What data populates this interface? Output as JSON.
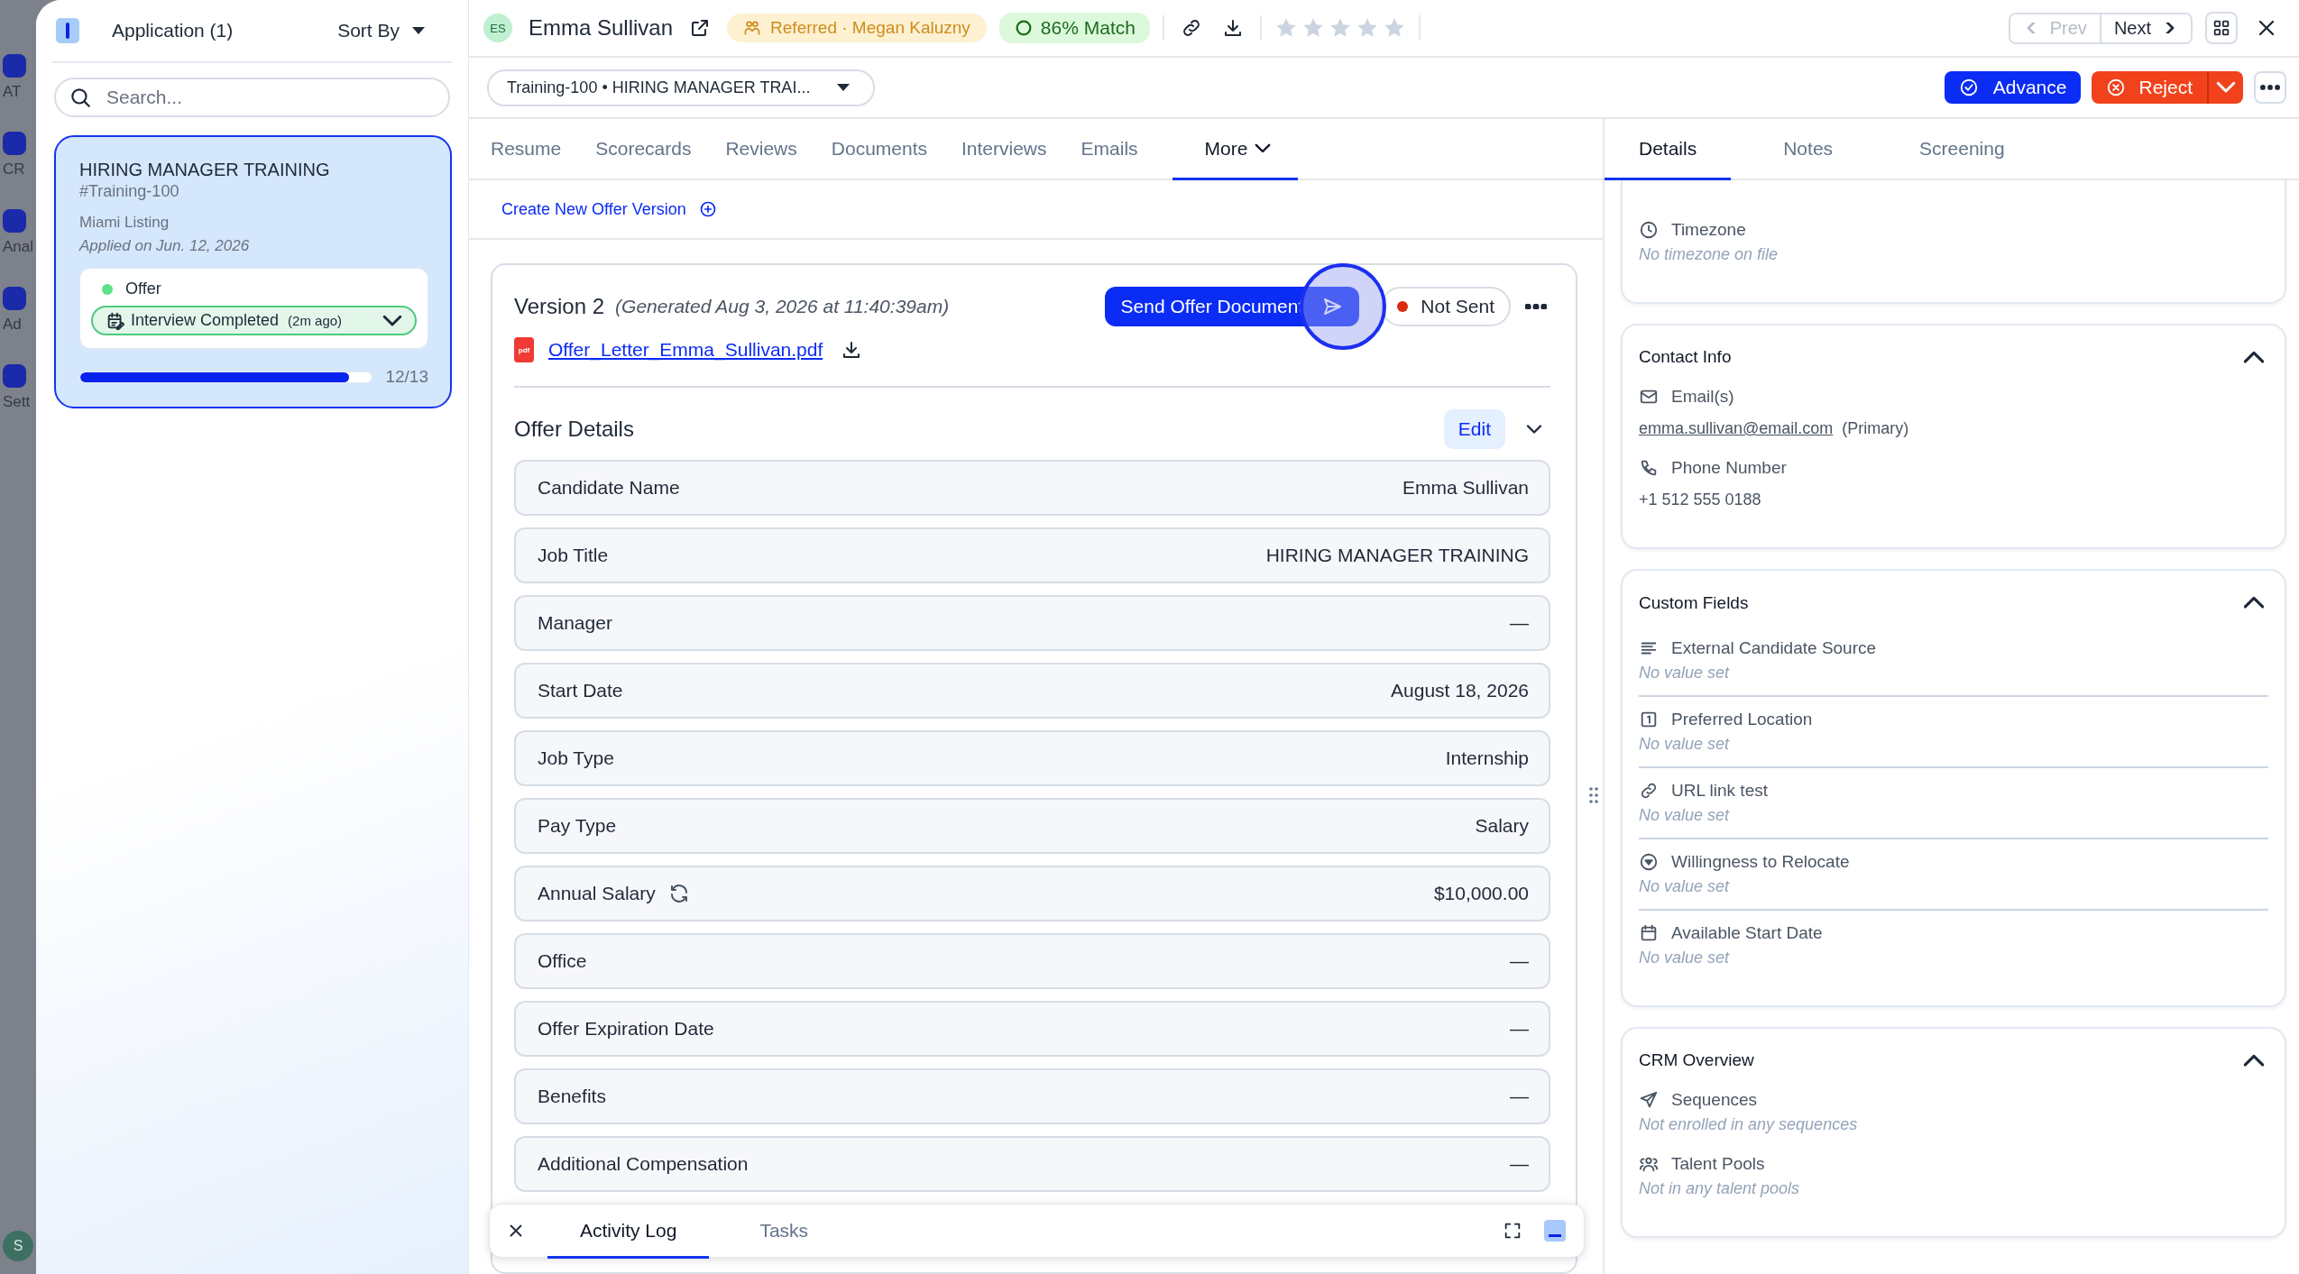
{
  "background_nav": {
    "items": [
      {
        "label": "AT"
      },
      {
        "label": "CR"
      },
      {
        "label": "Anal"
      },
      {
        "label": "Ad"
      },
      {
        "label": "Sett"
      }
    ],
    "avatar": "S"
  },
  "list_panel": {
    "title": "Application (1)",
    "sort_label": "Sort By",
    "search": {
      "placeholder": "Search..."
    },
    "cards": [
      {
        "title": "HIRING MANAGER TRAINING",
        "code": "#Training-100",
        "location": "Miami Listing",
        "applied": "Applied on Jun. 12, 2026",
        "selected": true,
        "stage": "Offer",
        "status": "Interview Completed",
        "status_time": "(2m ago)",
        "level": 0.92,
        "progress": "12/13"
      }
    ]
  },
  "header": {
    "initials": "ES",
    "name": "Emma Sullivan",
    "referral": "Referred · Megan Kaluzny",
    "match": "86% Match",
    "stars": 0,
    "prev": {
      "label": "Prev",
      "disabled": true
    },
    "next": {
      "label": "Next",
      "disabled": false
    }
  },
  "job_select": {
    "value": "Training-100 • HIRING MANAGER TRAI..."
  },
  "actions": {
    "advance": "Advance",
    "reject": "Reject"
  },
  "tabs": [
    {
      "label": "Resume",
      "selected": false
    },
    {
      "label": "Scorecards",
      "selected": false
    },
    {
      "label": "Reviews",
      "selected": false
    },
    {
      "label": "Documents",
      "selected": false
    },
    {
      "label": "Interviews",
      "selected": false
    },
    {
      "label": "Emails",
      "selected": false
    },
    {
      "label": "More",
      "selected": true,
      "kind": "menu"
    }
  ],
  "offer": {
    "create_link": "Create New Offer Version",
    "version": "Version 2",
    "generated": "(Generated Aug 3, 2026 at 11:40:39am)",
    "file_badge": "pdf",
    "file": "Offer_Letter_Emma_Sullivan.pdf",
    "send_button": "Send Offer Document",
    "status": "Not Sent",
    "details_title": "Offer Details",
    "edit": "Edit",
    "fields": [
      {
        "label": "Candidate Name",
        "value": "Emma Sullivan",
        "kind": "plain"
      },
      {
        "label": "Job Title",
        "value": "HIRING MANAGER TRAINING",
        "kind": "plain"
      },
      {
        "label": "Manager",
        "value": "—",
        "kind": "plain"
      },
      {
        "label": "Start Date",
        "value": "August 18, 2026",
        "kind": "plain"
      },
      {
        "label": "Job Type",
        "value": "Internship",
        "kind": "plain"
      },
      {
        "label": "Pay Type",
        "value": "Salary",
        "kind": "plain"
      },
      {
        "label": "Annual Salary",
        "value": "$10,000.00",
        "kind": "sync"
      },
      {
        "label": "Office",
        "value": "—",
        "kind": "plain"
      },
      {
        "label": "Offer Expiration Date",
        "value": "—",
        "kind": "plain"
      },
      {
        "label": "Benefits",
        "value": "—",
        "kind": "plain"
      },
      {
        "label": "Additional Compensation",
        "value": "—",
        "kind": "plain"
      }
    ]
  },
  "activity_tabs": [
    {
      "label": "Activity Log",
      "selected": true
    },
    {
      "label": "Tasks",
      "selected": false
    }
  ],
  "detail_tabs": [
    {
      "label": "Details",
      "selected": true
    },
    {
      "label": "Notes",
      "selected": false
    },
    {
      "label": "Screening",
      "selected": false
    }
  ],
  "detail_sections": [
    {
      "expanded": true,
      "divided": false,
      "items": [
        {
          "kind": "timezone",
          "label": "Timezone",
          "value": "No timezone on file",
          "empty": true
        }
      ]
    },
    {
      "title": "Contact Info",
      "expanded": true,
      "divided": false,
      "items": [
        {
          "kind": "email",
          "label": "Email(s)",
          "value": "emma.sullivan@email.com",
          "note": "(Primary)",
          "empty": false
        },
        {
          "kind": "phone",
          "label": "Phone Number",
          "value": "+1 512 555 0188",
          "empty": false
        }
      ]
    },
    {
      "title": "Custom Fields",
      "expanded": true,
      "divided": true,
      "items": [
        {
          "kind": "text",
          "label": "External Candidate Source",
          "value": "No value set",
          "empty": true
        },
        {
          "kind": "number",
          "label": "Preferred Location",
          "value": "No value set",
          "empty": true
        },
        {
          "kind": "link",
          "label": "URL link test",
          "value": "No value set",
          "empty": true
        },
        {
          "kind": "select",
          "label": "Willingness to Relocate",
          "value": "No value set",
          "empty": true
        },
        {
          "kind": "date",
          "label": "Available Start Date",
          "value": "No value set",
          "empty": true
        }
      ]
    },
    {
      "title": "CRM Overview",
      "expanded": true,
      "divided": false,
      "items": [
        {
          "kind": "sequences",
          "label": "Sequences",
          "value": "Not enrolled in any sequences",
          "empty": true
        },
        {
          "kind": "pools",
          "label": "Talent Pools",
          "value": "Not in any talent pools",
          "empty": true
        }
      ]
    }
  ]
}
